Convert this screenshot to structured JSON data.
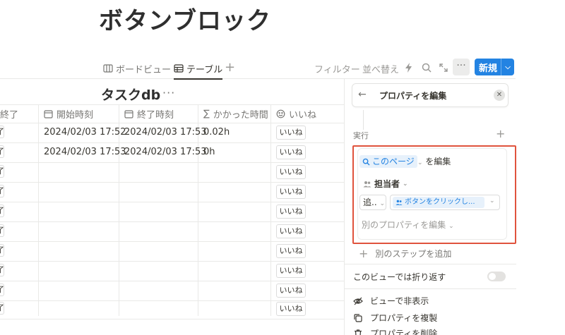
{
  "page": {
    "title": "ボタンブロック"
  },
  "view_bar": {
    "tabs": [
      {
        "label": "ボードビュー",
        "icon": "board-icon"
      },
      {
        "label": "テーブル",
        "icon": "table-icon",
        "active": true
      }
    ],
    "add_view": "+",
    "filter": "フィルター",
    "sort": "並べ替え",
    "new_button": "新規",
    "more": "···"
  },
  "database": {
    "title": "タスクdb",
    "more": "···",
    "columns": [
      {
        "label": "終了",
        "icon": ""
      },
      {
        "label": "開始時刻",
        "icon": "calendar-icon"
      },
      {
        "label": "終了時刻",
        "icon": "calendar-icon"
      },
      {
        "label": "かかった時間",
        "icon": "sigma-icon"
      },
      {
        "label": "いいね",
        "icon": "smile-icon"
      }
    ],
    "rows": [
      {
        "status": "了",
        "start": "2024/02/03 17:52",
        "end": "2024/02/03 17:53",
        "elapsed": "0.02h",
        "like": "いいね"
      },
      {
        "status": "了",
        "start": "2024/02/03 17:53",
        "end": "2024/02/03 17:53",
        "elapsed": "0h",
        "like": "いいね"
      },
      {
        "status": "了",
        "start": "",
        "end": "",
        "elapsed": "",
        "like": "いいね"
      },
      {
        "status": "了",
        "start": "",
        "end": "",
        "elapsed": "",
        "like": "いいね"
      },
      {
        "status": "了",
        "start": "",
        "end": "",
        "elapsed": "",
        "like": "いいね"
      },
      {
        "status": "了",
        "start": "",
        "end": "",
        "elapsed": "",
        "like": "いいね"
      },
      {
        "status": "了",
        "start": "",
        "end": "",
        "elapsed": "",
        "like": "いいね"
      },
      {
        "status": "了",
        "start": "",
        "end": "",
        "elapsed": "",
        "like": "いいね"
      },
      {
        "status": "了",
        "start": "",
        "end": "",
        "elapsed": "",
        "like": "いいね"
      },
      {
        "status": "了",
        "start": "",
        "end": "",
        "elapsed": "",
        "like": "いいね"
      }
    ]
  },
  "panel": {
    "title": "プロパティを編集",
    "section_label": "実行",
    "target_chip": "このページ",
    "target_suffix": "を編集",
    "property_name": "担当者",
    "action_value": "追..",
    "value_chip": "ボタンをクリックし...",
    "other_property": "別のプロパティを編集",
    "add_step": "別のステップを追加",
    "wrap_label": "このビューでは折り返す",
    "menu": [
      {
        "label": "ビューで非表示",
        "icon": "eye-off-icon"
      },
      {
        "label": "プロパティを複製",
        "icon": "duplicate-icon"
      },
      {
        "label": "プロパティを削除",
        "icon": "trash-icon"
      }
    ]
  },
  "colors": {
    "accent": "#2383e2",
    "highlight_border": "#e0533d"
  }
}
